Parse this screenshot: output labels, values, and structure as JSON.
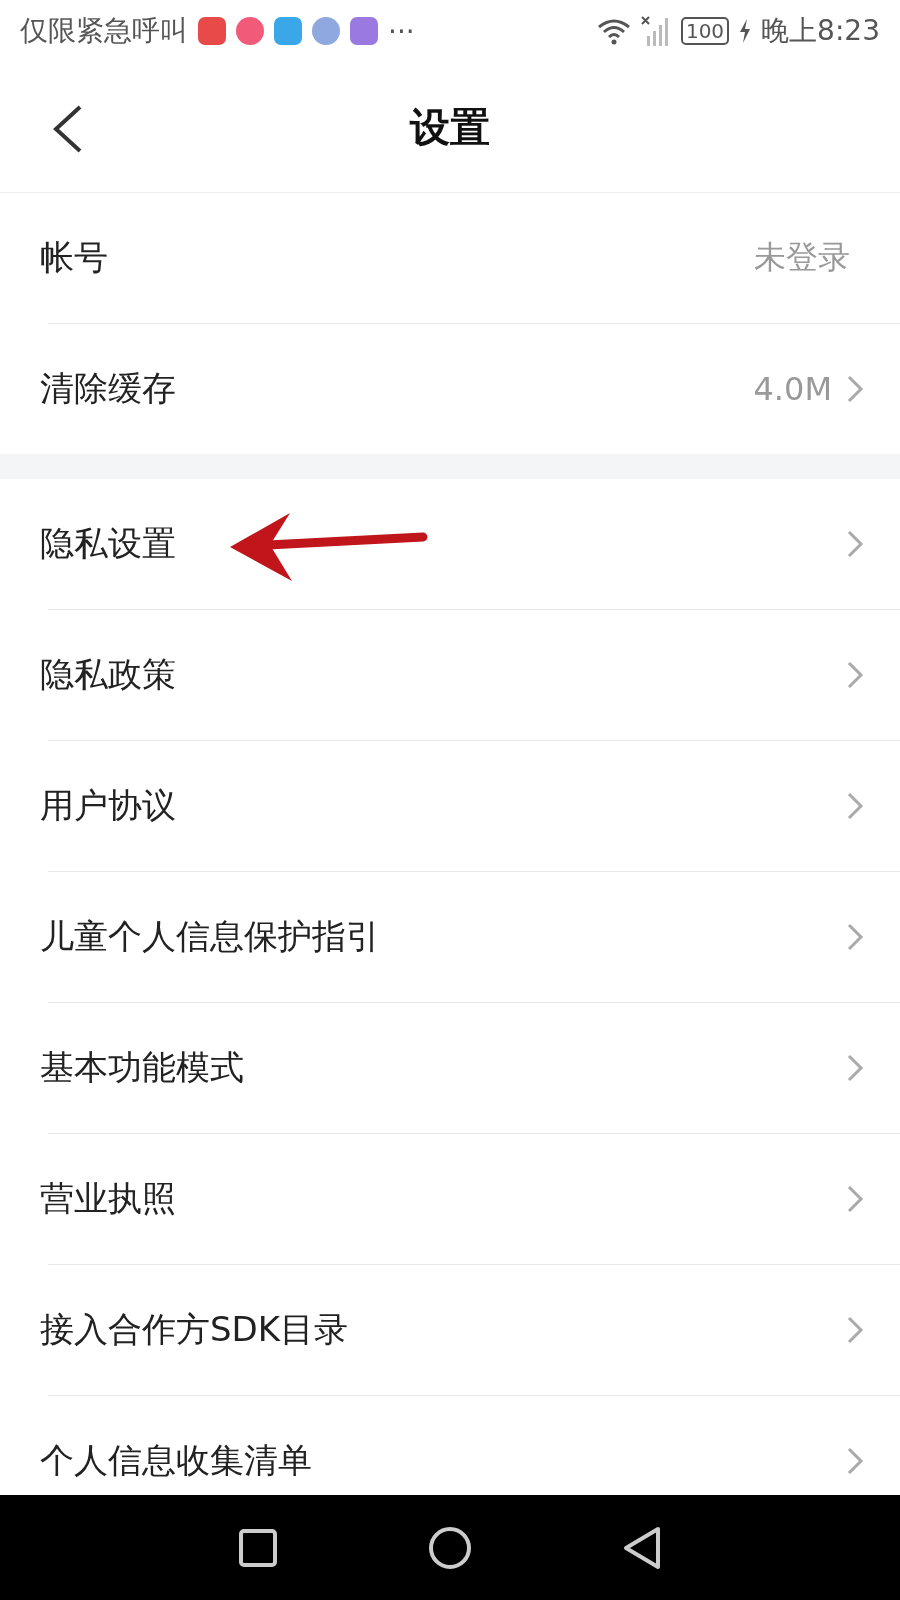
{
  "status_bar": {
    "notice": "仅限紧急呼叫",
    "more": "···",
    "battery": "100",
    "time": "晚上8:23"
  },
  "header": {
    "title": "设置"
  },
  "groups": [
    {
      "items": [
        {
          "label": "帐号",
          "value": "未登录",
          "chevron": false
        },
        {
          "label": "清除缓存",
          "value": "4.0M",
          "chevron": true
        }
      ]
    },
    {
      "items": [
        {
          "label": "隐私设置",
          "chevron": true
        },
        {
          "label": "隐私政策",
          "chevron": true
        },
        {
          "label": "用户协议",
          "chevron": true
        },
        {
          "label": "儿童个人信息保护指引",
          "chevron": true
        },
        {
          "label": "基本功能模式",
          "chevron": true
        },
        {
          "label": "营业执照",
          "chevron": true
        },
        {
          "label": "接入合作方SDK目录",
          "chevron": true
        },
        {
          "label": "个人信息收集清单",
          "chevron": true
        }
      ]
    }
  ]
}
